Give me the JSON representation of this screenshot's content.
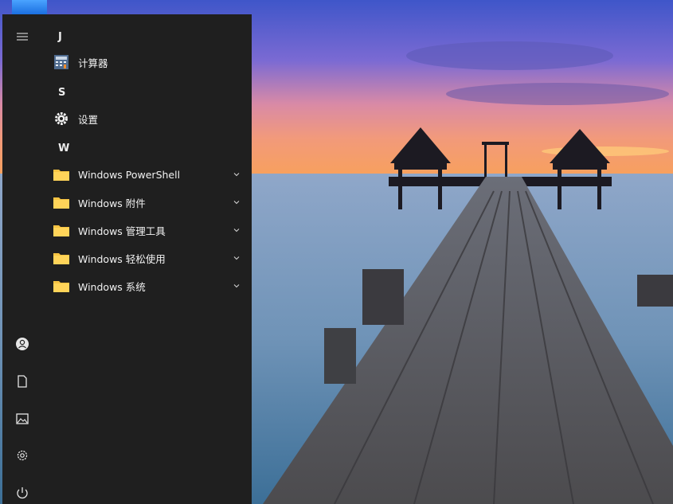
{
  "start_menu": {
    "rail": {
      "icons": [
        "hamburger-icon",
        "user-icon",
        "document-icon",
        "pictures-icon",
        "settings-icon",
        "power-icon"
      ]
    },
    "sections": [
      {
        "letter": "J",
        "items": [
          {
            "label": "计算器",
            "icon": "calculator-icon"
          }
        ]
      },
      {
        "letter": "S",
        "items": [
          {
            "label": "设置",
            "icon": "gear-icon"
          }
        ]
      },
      {
        "letter": "W",
        "items": [
          {
            "label": "Windows PowerShell",
            "icon": "folder-icon",
            "expandable": true
          },
          {
            "label": "Windows 附件",
            "icon": "folder-icon",
            "expandable": true
          },
          {
            "label": "Windows 管理工具",
            "icon": "folder-icon",
            "expandable": true
          },
          {
            "label": "Windows 轻松使用",
            "icon": "folder-icon",
            "expandable": true
          },
          {
            "label": "Windows 系统",
            "icon": "folder-icon",
            "expandable": true
          }
        ]
      }
    ]
  },
  "colors": {
    "menu_bg": "#1f1f1f",
    "folder": "#f6c342",
    "accent": "#1b6fe0"
  }
}
